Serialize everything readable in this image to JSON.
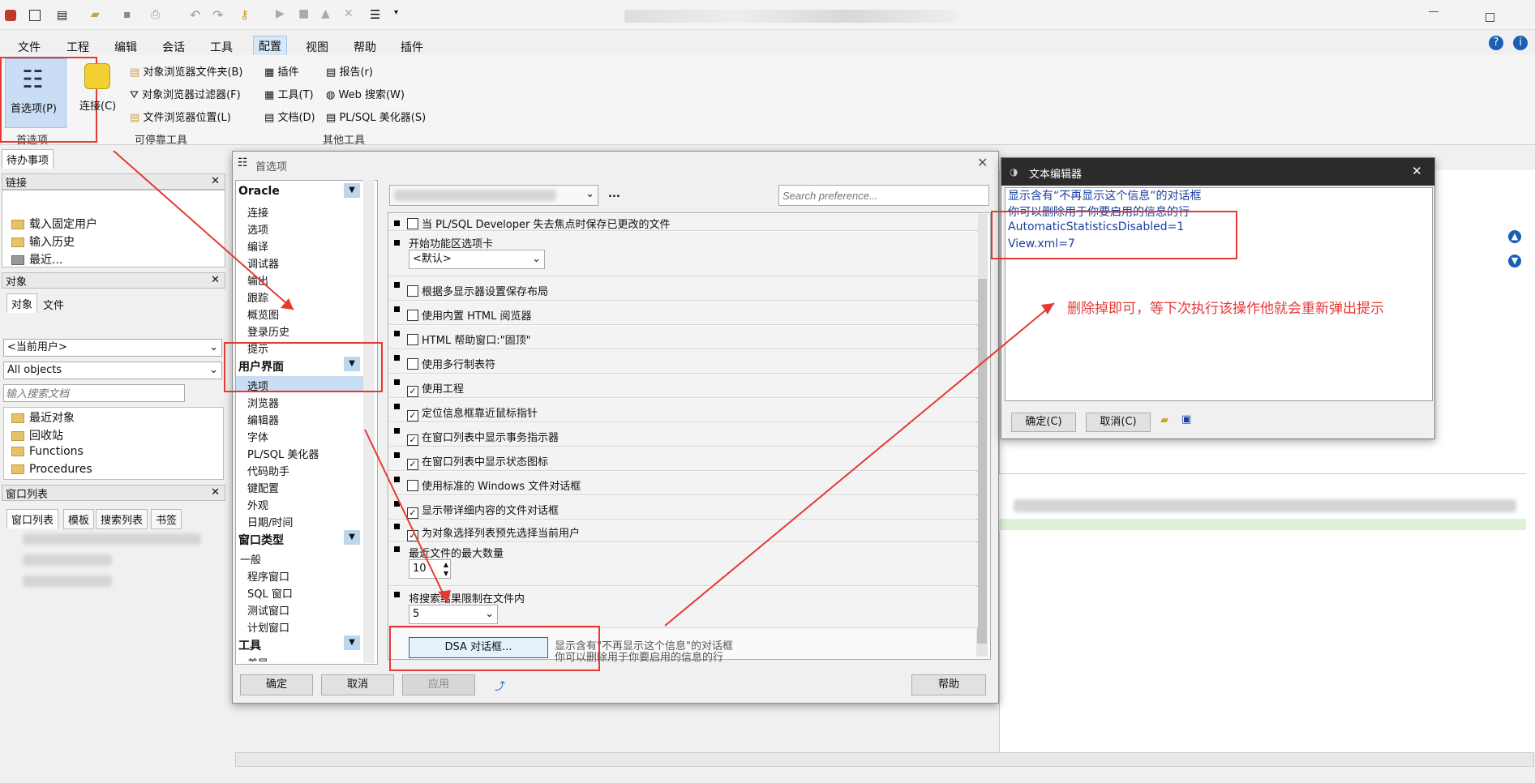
{
  "menubar": [
    "文件",
    "工程",
    "编辑",
    "会话",
    "工具",
    "配置",
    "视图",
    "帮助",
    "插件"
  ],
  "ribbon": {
    "preferences": "首选项(P)",
    "preferences_group": "首选项",
    "connect": "连接(C)",
    "dockable": [
      "对象浏览器文件夹(B)",
      "对象浏览器过滤器(F)",
      "文件浏览器位置(L)"
    ],
    "dockable_group": "可停靠工具",
    "other_col1": [
      "插件",
      "工具(T)",
      "文档(D)"
    ],
    "other_col2": [
      "报告(r)",
      "Web 搜索(W)",
      "PL/SQL 美化器(S)"
    ],
    "other_group": "其他工具"
  },
  "todo_tab": "待办事项",
  "conn_panel": {
    "title": "链接",
    "items": [
      "载入固定用户",
      "输入历史",
      "最近..."
    ]
  },
  "objects_panel": {
    "title": "对象",
    "tabs": [
      "对象",
      "文件"
    ],
    "user_combo": "<当前用户>",
    "filter_combo": "All objects",
    "search_placeholder": "输入搜索文档",
    "items": [
      "最近对象",
      "回收站",
      "Functions",
      "Procedures"
    ]
  },
  "window_list": {
    "title": "窗口列表",
    "tabs": [
      "窗口列表",
      "模板",
      "搜索列表",
      "书签"
    ]
  },
  "pref_dialog": {
    "title": "首选项",
    "search_placeholder": "Search preference...",
    "categories": [
      {
        "head": "Oracle",
        "items": [
          "连接",
          "选项",
          "编译",
          "调试器",
          "输出",
          "跟踪",
          "概览图",
          "登录历史",
          "提示"
        ]
      },
      {
        "head": "用户界面",
        "items": [
          "选项",
          "浏览器",
          "编辑器",
          "字体",
          "PL/SQL 美化器",
          "代码助手",
          "键配置",
          "外观",
          "日期/时间"
        ]
      },
      {
        "head": "窗口类型",
        "items": [
          "一般",
          "程序窗口",
          "SQL 窗口",
          "测试窗口",
          "计划窗口"
        ]
      },
      {
        "head": "工具",
        "items": [
          "差异"
        ]
      }
    ],
    "options": [
      {
        "label": "当 PL/SQL Developer 失去焦点时保存已更改的文件",
        "checked": false
      },
      {
        "label": "开始功能区选项卡",
        "combo": "<默认>"
      },
      {
        "label": "根据多显示器设置保存布局",
        "checked": false
      },
      {
        "label": "使用内置 HTML 阅览器",
        "checked": false
      },
      {
        "label": "HTML 帮助窗口:\"固顶\"",
        "checked": false
      },
      {
        "label": "使用多行制表符",
        "checked": false
      },
      {
        "label": "使用工程",
        "checked": true
      },
      {
        "label": "定位信息框靠近鼠标指针",
        "checked": true
      },
      {
        "label": "在窗口列表中显示事务指示器",
        "checked": true
      },
      {
        "label": "在窗口列表中显示状态图标",
        "checked": true
      },
      {
        "label": "使用标准的 Windows 文件对话框",
        "checked": false
      },
      {
        "label": "显示带详细内容的文件对话框",
        "checked": true
      },
      {
        "label": "为对象选择列表预先选择当前用户",
        "checked": true
      },
      {
        "label": "最近文件的最大数量",
        "spin": "10"
      },
      {
        "label": "将搜索结果限制在文件内",
        "combo": "5"
      }
    ],
    "dsa_button": "DSA 对话框...",
    "dsa_desc1": "显示含有\"不再显示这个信息\"的对话框",
    "dsa_desc2": "你可以删除用于你要启用的信息的行",
    "ok": "确定",
    "cancel": "取消",
    "apply": "应用",
    "help": "帮助"
  },
  "text_editor": {
    "title": "文本编辑器",
    "lines": [
      "显示含有“不再显示这个信息”的对话框",
      "你可以删除用于你要启用的信息的行",
      "AutomaticStatisticsDisabled=1",
      "View.xml=7"
    ],
    "ok": "确定(C)",
    "cancel": "取消(C)"
  },
  "annotation": "删除掉即可，等下次执行该操作他就会重新弹出提示",
  "colors": {
    "red": "#e53935",
    "accent": "#1a5fb4",
    "selected": "#c9def5"
  }
}
